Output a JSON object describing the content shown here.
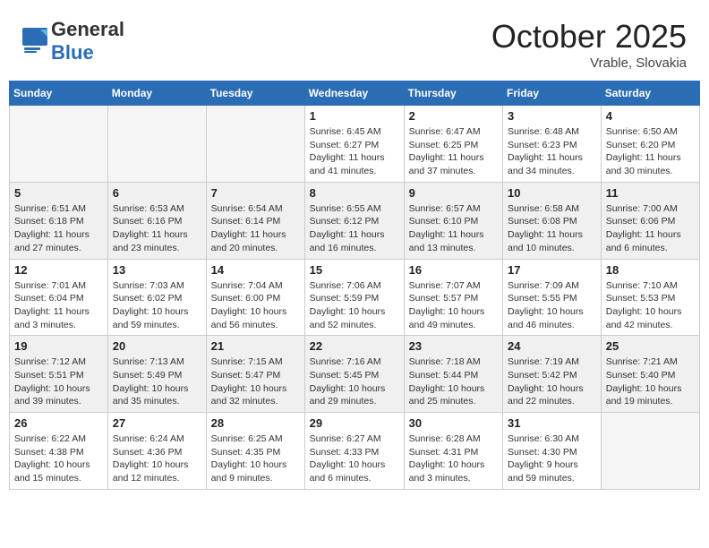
{
  "header": {
    "logo_general": "General",
    "logo_blue": "Blue",
    "month_title": "October 2025",
    "location": "Vrable, Slovakia"
  },
  "weekdays": [
    "Sunday",
    "Monday",
    "Tuesday",
    "Wednesday",
    "Thursday",
    "Friday",
    "Saturday"
  ],
  "weeks": [
    [
      {
        "day": "",
        "info": ""
      },
      {
        "day": "",
        "info": ""
      },
      {
        "day": "",
        "info": ""
      },
      {
        "day": "1",
        "info": "Sunrise: 6:45 AM\nSunset: 6:27 PM\nDaylight: 11 hours\nand 41 minutes."
      },
      {
        "day": "2",
        "info": "Sunrise: 6:47 AM\nSunset: 6:25 PM\nDaylight: 11 hours\nand 37 minutes."
      },
      {
        "day": "3",
        "info": "Sunrise: 6:48 AM\nSunset: 6:23 PM\nDaylight: 11 hours\nand 34 minutes."
      },
      {
        "day": "4",
        "info": "Sunrise: 6:50 AM\nSunset: 6:20 PM\nDaylight: 11 hours\nand 30 minutes."
      }
    ],
    [
      {
        "day": "5",
        "info": "Sunrise: 6:51 AM\nSunset: 6:18 PM\nDaylight: 11 hours\nand 27 minutes."
      },
      {
        "day": "6",
        "info": "Sunrise: 6:53 AM\nSunset: 6:16 PM\nDaylight: 11 hours\nand 23 minutes."
      },
      {
        "day": "7",
        "info": "Sunrise: 6:54 AM\nSunset: 6:14 PM\nDaylight: 11 hours\nand 20 minutes."
      },
      {
        "day": "8",
        "info": "Sunrise: 6:55 AM\nSunset: 6:12 PM\nDaylight: 11 hours\nand 16 minutes."
      },
      {
        "day": "9",
        "info": "Sunrise: 6:57 AM\nSunset: 6:10 PM\nDaylight: 11 hours\nand 13 minutes."
      },
      {
        "day": "10",
        "info": "Sunrise: 6:58 AM\nSunset: 6:08 PM\nDaylight: 11 hours\nand 10 minutes."
      },
      {
        "day": "11",
        "info": "Sunrise: 7:00 AM\nSunset: 6:06 PM\nDaylight: 11 hours\nand 6 minutes."
      }
    ],
    [
      {
        "day": "12",
        "info": "Sunrise: 7:01 AM\nSunset: 6:04 PM\nDaylight: 11 hours\nand 3 minutes."
      },
      {
        "day": "13",
        "info": "Sunrise: 7:03 AM\nSunset: 6:02 PM\nDaylight: 10 hours\nand 59 minutes."
      },
      {
        "day": "14",
        "info": "Sunrise: 7:04 AM\nSunset: 6:00 PM\nDaylight: 10 hours\nand 56 minutes."
      },
      {
        "day": "15",
        "info": "Sunrise: 7:06 AM\nSunset: 5:59 PM\nDaylight: 10 hours\nand 52 minutes."
      },
      {
        "day": "16",
        "info": "Sunrise: 7:07 AM\nSunset: 5:57 PM\nDaylight: 10 hours\nand 49 minutes."
      },
      {
        "day": "17",
        "info": "Sunrise: 7:09 AM\nSunset: 5:55 PM\nDaylight: 10 hours\nand 46 minutes."
      },
      {
        "day": "18",
        "info": "Sunrise: 7:10 AM\nSunset: 5:53 PM\nDaylight: 10 hours\nand 42 minutes."
      }
    ],
    [
      {
        "day": "19",
        "info": "Sunrise: 7:12 AM\nSunset: 5:51 PM\nDaylight: 10 hours\nand 39 minutes."
      },
      {
        "day": "20",
        "info": "Sunrise: 7:13 AM\nSunset: 5:49 PM\nDaylight: 10 hours\nand 35 minutes."
      },
      {
        "day": "21",
        "info": "Sunrise: 7:15 AM\nSunset: 5:47 PM\nDaylight: 10 hours\nand 32 minutes."
      },
      {
        "day": "22",
        "info": "Sunrise: 7:16 AM\nSunset: 5:45 PM\nDaylight: 10 hours\nand 29 minutes."
      },
      {
        "day": "23",
        "info": "Sunrise: 7:18 AM\nSunset: 5:44 PM\nDaylight: 10 hours\nand 25 minutes."
      },
      {
        "day": "24",
        "info": "Sunrise: 7:19 AM\nSunset: 5:42 PM\nDaylight: 10 hours\nand 22 minutes."
      },
      {
        "day": "25",
        "info": "Sunrise: 7:21 AM\nSunset: 5:40 PM\nDaylight: 10 hours\nand 19 minutes."
      }
    ],
    [
      {
        "day": "26",
        "info": "Sunrise: 6:22 AM\nSunset: 4:38 PM\nDaylight: 10 hours\nand 15 minutes."
      },
      {
        "day": "27",
        "info": "Sunrise: 6:24 AM\nSunset: 4:36 PM\nDaylight: 10 hours\nand 12 minutes."
      },
      {
        "day": "28",
        "info": "Sunrise: 6:25 AM\nSunset: 4:35 PM\nDaylight: 10 hours\nand 9 minutes."
      },
      {
        "day": "29",
        "info": "Sunrise: 6:27 AM\nSunset: 4:33 PM\nDaylight: 10 hours\nand 6 minutes."
      },
      {
        "day": "30",
        "info": "Sunrise: 6:28 AM\nSunset: 4:31 PM\nDaylight: 10 hours\nand 3 minutes."
      },
      {
        "day": "31",
        "info": "Sunrise: 6:30 AM\nSunset: 4:30 PM\nDaylight: 9 hours\nand 59 minutes."
      },
      {
        "day": "",
        "info": ""
      }
    ]
  ]
}
